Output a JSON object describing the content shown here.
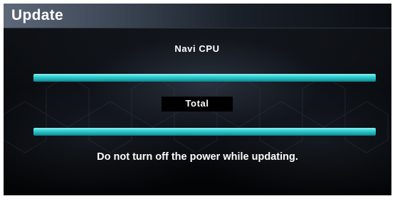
{
  "screen": {
    "title": "Update"
  },
  "navi_cpu": {
    "label": "Navi CPU",
    "progress_fraction": 1.0
  },
  "total": {
    "label": "Total",
    "progress_fraction": 1.0
  },
  "message": "Do not turn off the power while updating.",
  "colors": {
    "accent_progress": "#2fc6cb",
    "background": "#05070a",
    "header": "#4a5564",
    "text": "#ffffff"
  }
}
